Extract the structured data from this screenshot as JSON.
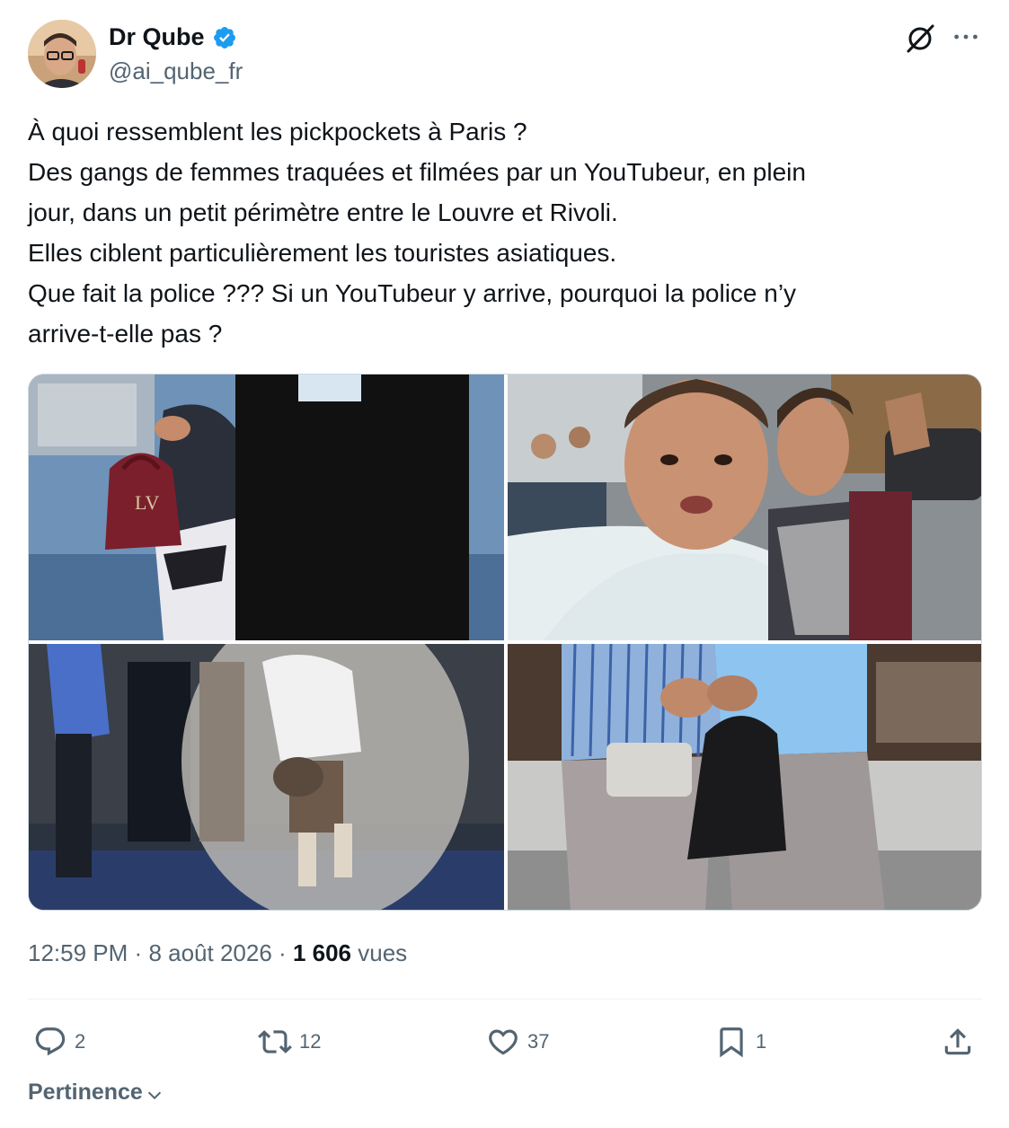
{
  "author": {
    "display_name": "Dr Qube",
    "handle": "@ai_qube_fr",
    "verified": true,
    "verified_color": "#1d9bf0"
  },
  "tweet": {
    "lines": [
      "À quoi ressemblent les pickpockets à Paris ?",
      "Des gangs de femmes traquées et filmées par un YouTubeur, en plein",
      "jour, dans un petit périmètre entre le Louvre et Rivoli.",
      "Elles ciblent particulièrement les touristes asiatiques.",
      "Que fait la police ??? Si un YouTubeur y arrive, pourquoi la police n’y",
      "arrive-t-elle pas ?"
    ],
    "media_count": 4
  },
  "meta": {
    "time": "12:59 PM",
    "separator": "·",
    "date": "8 août 2026",
    "views_count": "1 606",
    "views_label": "vues"
  },
  "actions": {
    "replies": "2",
    "reposts": "12",
    "likes": "37",
    "bookmarks": "1"
  },
  "sort": {
    "label": "Pertinence"
  },
  "icons": {
    "header": [
      "grok-icon",
      "more-icon"
    ],
    "actions": [
      "reply-icon",
      "repost-icon",
      "like-icon",
      "bookmark-icon",
      "share-icon"
    ],
    "sort": "chevron-down-icon"
  },
  "colors": {
    "text": "#0f1419",
    "secondary": "#536471",
    "divider": "#eff3f4"
  }
}
